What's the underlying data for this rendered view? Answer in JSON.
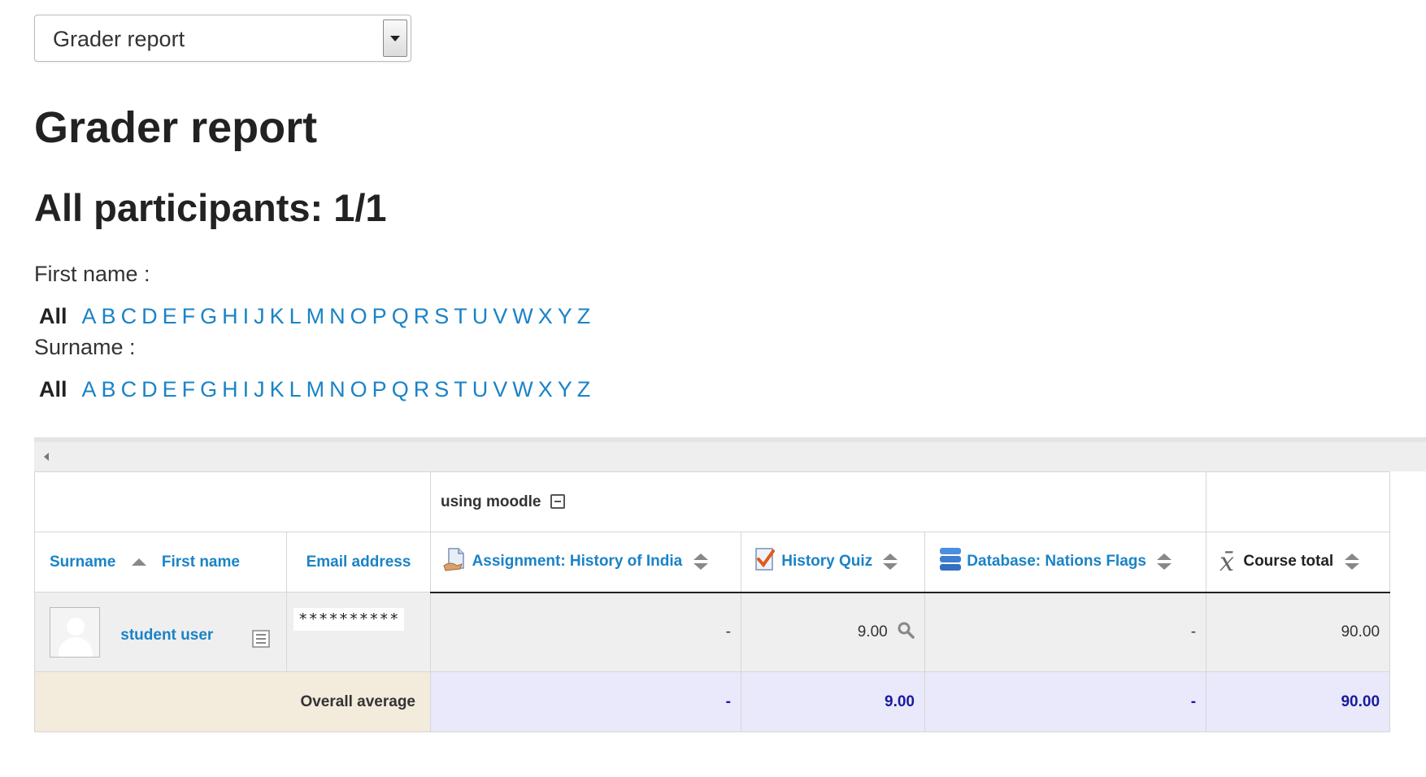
{
  "report_select": {
    "value": "Grader report"
  },
  "page_title": "Grader report",
  "participants_heading": "All participants: 1/1",
  "firstname_filter": {
    "label": "First name :",
    "all": "All"
  },
  "surname_filter": {
    "label": "Surname :",
    "all": "All"
  },
  "letters": [
    "A",
    "B",
    "C",
    "D",
    "E",
    "F",
    "G",
    "H",
    "I",
    "J",
    "K",
    "L",
    "M",
    "N",
    "O",
    "P",
    "Q",
    "R",
    "S",
    "T",
    "U",
    "V",
    "W",
    "X",
    "Y",
    "Z"
  ],
  "table": {
    "category": "using moodle",
    "headers": {
      "surname": "Surname",
      "firstname": "First name",
      "email": "Email address",
      "assignment": "Assignment: History of India",
      "quiz": "History Quiz",
      "database": "Database: Nations Flags",
      "course_total": "Course total"
    },
    "student": {
      "name": "student user",
      "email": "**********",
      "assignment": "-",
      "quiz": "9.00",
      "database": "-",
      "course_total": "90.00"
    },
    "average": {
      "label": "Overall average",
      "assignment": "-",
      "quiz": "9.00",
      "database": "-",
      "course_total": "90.00"
    }
  },
  "colors": {
    "link": "#1a83c6",
    "average_text": "#1a1aa0",
    "average_label_bg": "#f3ebdc",
    "average_row_bg": "#e9e9fb"
  }
}
